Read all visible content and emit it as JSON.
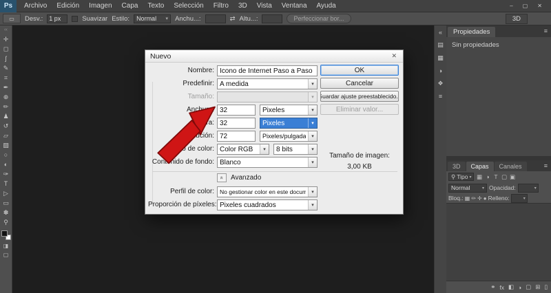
{
  "colors": {
    "accent": "#3a7fd5",
    "arrow_red": "#cf1515"
  },
  "titlebar": {
    "logo": "Ps",
    "menus": [
      "Archivo",
      "Edición",
      "Imagen",
      "Capa",
      "Texto",
      "Selección",
      "Filtro",
      "3D",
      "Vista",
      "Ventana",
      "Ayuda"
    ],
    "window_controls": [
      {
        "name": "minimize-button",
        "glyph": "–"
      },
      {
        "name": "restore-button",
        "glyph": "▢"
      },
      {
        "name": "close-button",
        "glyph": "✕"
      }
    ]
  },
  "options_bar": {
    "tool_preset_icon": "▭",
    "desv_label": "Desv.:",
    "desv_value": "1 px",
    "suavizar_label": "Suavizar",
    "estilo_label": "Estilo:",
    "estilo_value": "Normal",
    "anchura_label": "Anchu...:",
    "swap_icon": "⇄",
    "altura_label": "Altu...:",
    "perfeccionar_label": "Perfeccionar bor...",
    "workspace_label": "3D"
  },
  "toolbox": {
    "grip_icon": "‹‹",
    "quick_mask_icon": "◨",
    "screen_mode_icon": "▢",
    "tools": [
      {
        "name": "move-tool-icon",
        "glyph": "✛"
      },
      {
        "name": "marquee-tool-icon",
        "glyph": "◻"
      },
      {
        "name": "lasso-tool-icon",
        "glyph": "ʃ"
      },
      {
        "name": "quick-selection-tool-icon",
        "glyph": "✎"
      },
      {
        "name": "crop-tool-icon",
        "glyph": "⌗"
      },
      {
        "name": "eyedropper-tool-icon",
        "glyph": "✒"
      },
      {
        "name": "healing-brush-tool-icon",
        "glyph": "⊕"
      },
      {
        "name": "brush-tool-icon",
        "glyph": "✏"
      },
      {
        "name": "clone-stamp-tool-icon",
        "glyph": "♟"
      },
      {
        "name": "history-brush-tool-icon",
        "glyph": "↺"
      },
      {
        "name": "eraser-tool-icon",
        "glyph": "▱"
      },
      {
        "name": "gradient-tool-icon",
        "glyph": "▨"
      },
      {
        "name": "blur-tool-icon",
        "glyph": "○"
      },
      {
        "name": "dodge-tool-icon",
        "glyph": "◐"
      },
      {
        "name": "pen-tool-icon",
        "glyph": "✑"
      },
      {
        "name": "type-tool-icon",
        "glyph": "T"
      },
      {
        "name": "path-selection-tool-icon",
        "glyph": "▷"
      },
      {
        "name": "rectangle-tool-icon",
        "glyph": "▭"
      },
      {
        "name": "hand-tool-icon",
        "glyph": "✽"
      },
      {
        "name": "zoom-tool-icon",
        "glyph": "⚲"
      }
    ]
  },
  "dock_strip": {
    "icons": [
      {
        "name": "collapse-dock-icon",
        "glyph": "«"
      },
      {
        "name": "color-panel-icon",
        "glyph": "▤"
      },
      {
        "name": "swatches-panel-icon",
        "glyph": "▦"
      },
      {
        "name": "adjustments-panel-icon",
        "glyph": "◑"
      },
      {
        "name": "styles-panel-icon",
        "glyph": "❖"
      },
      {
        "name": "info-panel-icon",
        "glyph": "≡"
      }
    ]
  },
  "panels": {
    "propiedades": {
      "tab_label": "Propiedades",
      "menu_icon": "≡",
      "empty_text": "Sin propiedades"
    },
    "layers": {
      "tab_3d": "3D",
      "tab_capas": "Capas",
      "tab_canales": "Canales",
      "menu_icon": "≡",
      "search_icon": "⚲",
      "filter_label": "Tipo",
      "filter_icons": [
        {
          "name": "filter-pixel-layers-icon",
          "glyph": "▦"
        },
        {
          "name": "filter-adjustment-layers-icon",
          "glyph": "◑"
        },
        {
          "name": "filter-type-layers-icon",
          "glyph": "T"
        },
        {
          "name": "filter-shape-layers-icon",
          "glyph": "▢"
        },
        {
          "name": "filter-smart-objects-icon",
          "glyph": "▣"
        }
      ],
      "blend_mode": "Normal",
      "opacidad_label": "Opacidad:",
      "bloq_label": "Bloq.:",
      "lock_icons": [
        {
          "name": "lock-transparency-icon",
          "glyph": "▦"
        },
        {
          "name": "lock-pixels-icon",
          "glyph": "✏"
        },
        {
          "name": "lock-position-icon",
          "glyph": "✛"
        },
        {
          "name": "lock-all-icon",
          "glyph": "●"
        }
      ],
      "relleno_label": "Relleno:",
      "bottom_icons": [
        {
          "name": "link-layers-icon",
          "glyph": "⚭"
        },
        {
          "name": "layer-effects-icon",
          "glyph": "fx"
        },
        {
          "name": "add-mask-icon",
          "glyph": "◧"
        },
        {
          "name": "adjustment-layer-icon",
          "glyph": "◑"
        },
        {
          "name": "new-group-icon",
          "glyph": "▢"
        },
        {
          "name": "new-layer-icon",
          "glyph": "⊞"
        },
        {
          "name": "delete-layer-icon",
          "glyph": "▯"
        }
      ]
    }
  },
  "dialog": {
    "title": "Nuevo",
    "close_icon": "✕",
    "nombre_label": "Nombre:",
    "nombre_value": "Icono de Internet Paso a Paso",
    "predefinir_label": "Predefinir:",
    "predefinir_value": "A medida",
    "tamano_label": "Tamaño:",
    "tamano_value": "",
    "anchura_label": "Anchura:",
    "anchura_value": "32",
    "anchura_unit": "Pixeles",
    "altura_label": "Altura:",
    "altura_value": "32",
    "altura_unit": "Pixeles",
    "resolucion_label": "Resolución:",
    "resolucion_value": "72",
    "resolucion_unit": "Pixeles/pulgada",
    "modo_label": "Modo de color:",
    "modo_value": "Color RGB",
    "bits_value": "8 bits",
    "fondo_label": "Contenido de fondo:",
    "fondo_value": "Blanco",
    "ok_label": "OK",
    "cancelar_label": "Cancelar",
    "guardar_label": "Guardar ajuste preestablecido...",
    "eliminar_label": "Eliminar valor...",
    "tamano_imagen_label": "Tamaño de imagen:",
    "tamano_imagen_value": "3,00 KB",
    "avanzado_icon": "«",
    "avanzado_label": "Avanzado",
    "perfil_label": "Perfil de color:",
    "perfil_value": "No gestionar color en este documento",
    "proporcion_label": "Proporción de píxeles:",
    "proporcion_value": "Pixeles cuadrados"
  }
}
